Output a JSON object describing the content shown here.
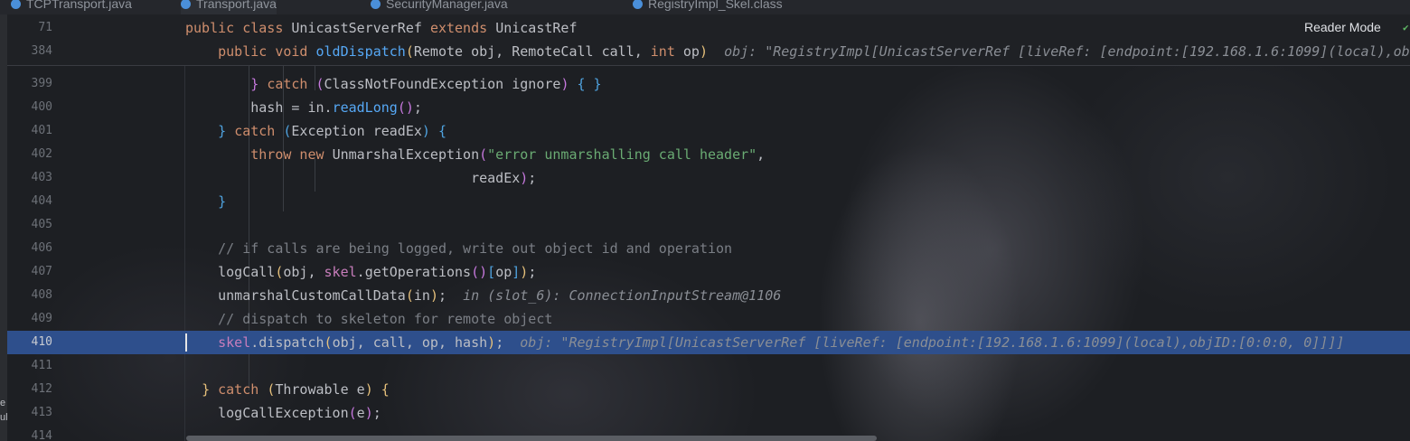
{
  "tabs": [
    {
      "label": "TCPTransport.java",
      "selected": false
    },
    {
      "label": "Transport.java",
      "selected": true
    },
    {
      "label": "SecurityManager.java",
      "selected": false
    },
    {
      "label": "RegistryImpl_Skel.class",
      "selected": false
    }
  ],
  "reader_mode": "Reader Mode",
  "sticky": [
    {
      "ln": "71",
      "tokens": [
        [
          "kw",
          "public class "
        ],
        [
          "plain",
          "UnicastServerRef "
        ],
        [
          "kw",
          "extends "
        ],
        [
          "plain",
          "UnicastRef"
        ]
      ]
    },
    {
      "ln": "384",
      "tokens": [
        [
          "plain",
          "    "
        ],
        [
          "kw",
          "public void "
        ],
        [
          "fn",
          "oldDispatch"
        ],
        [
          "br1",
          "("
        ],
        [
          "plain",
          "Remote obj, RemoteCall call, "
        ],
        [
          "kw",
          "int "
        ],
        [
          "plain",
          "op"
        ],
        [
          "br1",
          ")"
        ],
        [
          "plain",
          "  "
        ],
        [
          "hint",
          "obj: \"RegistryImpl[UnicastServerRef [liveRef: [endpoint:[192.168.1.6:1099](local),ob"
        ]
      ]
    }
  ],
  "lines": [
    {
      "ln": "399",
      "tokens": [
        [
          "plain",
          "        "
        ],
        [
          "br2",
          "} "
        ],
        [
          "kw",
          "catch "
        ],
        [
          "br2",
          "("
        ],
        [
          "plain",
          "ClassNotFoundException ignore"
        ],
        [
          "br2",
          ") "
        ],
        [
          "br3",
          "{ }"
        ]
      ]
    },
    {
      "ln": "400",
      "tokens": [
        [
          "plain",
          "        hash = in."
        ],
        [
          "fn",
          "readLong"
        ],
        [
          "br2",
          "()"
        ],
        [
          "plain",
          ";"
        ]
      ]
    },
    {
      "ln": "401",
      "tokens": [
        [
          "plain",
          "    "
        ],
        [
          "br3",
          "} "
        ],
        [
          "kw",
          "catch "
        ],
        [
          "br3",
          "("
        ],
        [
          "plain",
          "Exception readEx"
        ],
        [
          "br3",
          ") {"
        ]
      ]
    },
    {
      "ln": "402",
      "tokens": [
        [
          "plain",
          "        "
        ],
        [
          "kw",
          "throw new "
        ],
        [
          "plain",
          "UnmarshalException"
        ],
        [
          "br2",
          "("
        ],
        [
          "str",
          "\"error unmarshalling call header\""
        ],
        [
          "plain",
          ","
        ]
      ]
    },
    {
      "ln": "403",
      "tokens": [
        [
          "plain",
          "                                   readEx"
        ],
        [
          "br2",
          ")"
        ],
        [
          "plain",
          ";"
        ]
      ]
    },
    {
      "ln": "404",
      "tokens": [
        [
          "plain",
          "    "
        ],
        [
          "br3",
          "}"
        ]
      ]
    },
    {
      "ln": "405",
      "tokens": []
    },
    {
      "ln": "406",
      "tokens": [
        [
          "plain",
          "    "
        ],
        [
          "cmt",
          "// if calls are being logged, write out object id and operation"
        ]
      ]
    },
    {
      "ln": "407",
      "tokens": [
        [
          "plain",
          "    logCall"
        ],
        [
          "br1",
          "("
        ],
        [
          "plain",
          "obj, "
        ],
        [
          "field",
          "skel"
        ],
        [
          "plain",
          "."
        ],
        [
          "plain",
          "getOperations"
        ],
        [
          "br2",
          "()"
        ],
        [
          "br3",
          "["
        ],
        [
          "plain",
          "op"
        ],
        [
          "br3",
          "]"
        ],
        [
          "br1",
          ")"
        ],
        [
          "plain",
          ";"
        ]
      ]
    },
    {
      "ln": "408",
      "tokens": [
        [
          "plain",
          "    unmarshalCustomCallData"
        ],
        [
          "br1",
          "("
        ],
        [
          "plain",
          "in"
        ],
        [
          "br1",
          ")"
        ],
        [
          "plain",
          ";  "
        ],
        [
          "hint",
          "in (slot_6): ConnectionInputStream@1106"
        ]
      ]
    },
    {
      "ln": "409",
      "tokens": [
        [
          "plain",
          "    "
        ],
        [
          "cmt",
          "// dispatch to skeleton for remote object"
        ]
      ]
    },
    {
      "ln": "410",
      "current": true,
      "tokens": [
        [
          "plain",
          "    "
        ],
        [
          "field",
          "skel"
        ],
        [
          "plain",
          ".dispatch"
        ],
        [
          "br1",
          "("
        ],
        [
          "plain",
          "obj, call, op, hash"
        ],
        [
          "br1",
          ")"
        ],
        [
          "plain",
          ";  "
        ],
        [
          "hint",
          "obj: \"RegistryImpl[UnicastServerRef [liveRef: [endpoint:[192.168.1.6:1099](local),objID:[0:0:0, 0]]]]"
        ]
      ]
    },
    {
      "ln": "411",
      "tokens": []
    },
    {
      "ln": "412",
      "tokens": [
        [
          "plain",
          "  "
        ],
        [
          "br1",
          "} "
        ],
        [
          "kw",
          "catch "
        ],
        [
          "br1",
          "("
        ],
        [
          "plain",
          "Throwable e"
        ],
        [
          "br1",
          ") {"
        ]
      ]
    },
    {
      "ln": "413",
      "tokens": [
        [
          "plain",
          "    logCallException"
        ],
        [
          "br2",
          "("
        ],
        [
          "plain",
          "e"
        ],
        [
          "br2",
          ")"
        ],
        [
          "plain",
          ";"
        ]
      ]
    },
    {
      "ln": "414",
      "tokens": []
    }
  ],
  "left_strip": [
    "e",
    "ul"
  ]
}
